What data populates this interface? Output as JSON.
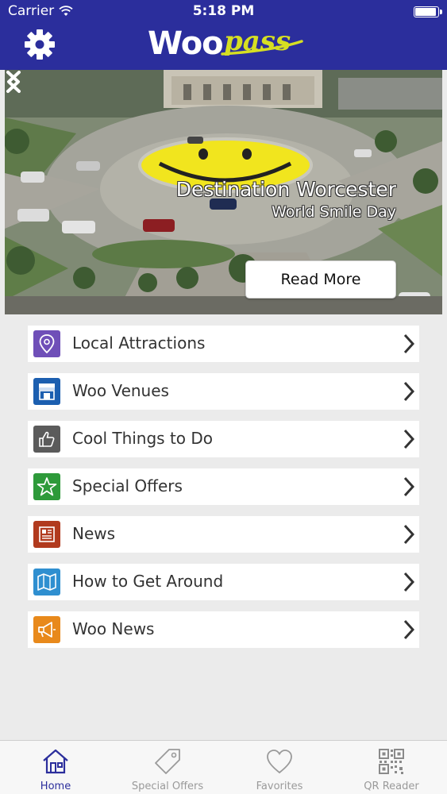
{
  "status_bar": {
    "carrier": "Carrier",
    "time": "5:18 PM",
    "wifi_icon": "wifi-icon",
    "battery_icon": "battery-icon"
  },
  "header": {
    "settings_icon": "gear-icon",
    "logo_primary": "Woo",
    "logo_secondary": "pass",
    "background_color": "#2b2e9c"
  },
  "hero": {
    "title": "Destination Worcester",
    "subtitle": "World Smile Day",
    "read_more_label": "Read More",
    "prev_icon": "chevron-left-icon",
    "next_icon": "chevron-right-icon"
  },
  "menu": {
    "items": [
      {
        "label": "Local Attractions",
        "icon": "map-pin-icon",
        "color": "#6f4fb8"
      },
      {
        "label": "Woo Venues",
        "icon": "storefront-icon",
        "color": "#1c5fb0"
      },
      {
        "label": "Cool Things to Do",
        "icon": "thumbs-up-icon",
        "color": "#5b5b5b"
      },
      {
        "label": "Special Offers",
        "icon": "star-icon",
        "color": "#2e9a3a"
      },
      {
        "label": "News",
        "icon": "newspaper-icon",
        "color": "#b13a1e"
      },
      {
        "label": "How to Get Around",
        "icon": "map-icon",
        "color": "#2f8fd0"
      },
      {
        "label": "Woo News",
        "icon": "megaphone-icon",
        "color": "#e8891b"
      }
    ]
  },
  "tabbar": {
    "tabs": [
      {
        "label": "Home",
        "icon": "home-icon",
        "active": true
      },
      {
        "label": "Special Offers",
        "icon": "tag-icon",
        "active": false
      },
      {
        "label": "Favorites",
        "icon": "heart-icon",
        "active": false
      },
      {
        "label": "QR Reader",
        "icon": "qr-code-icon",
        "active": false
      }
    ]
  }
}
